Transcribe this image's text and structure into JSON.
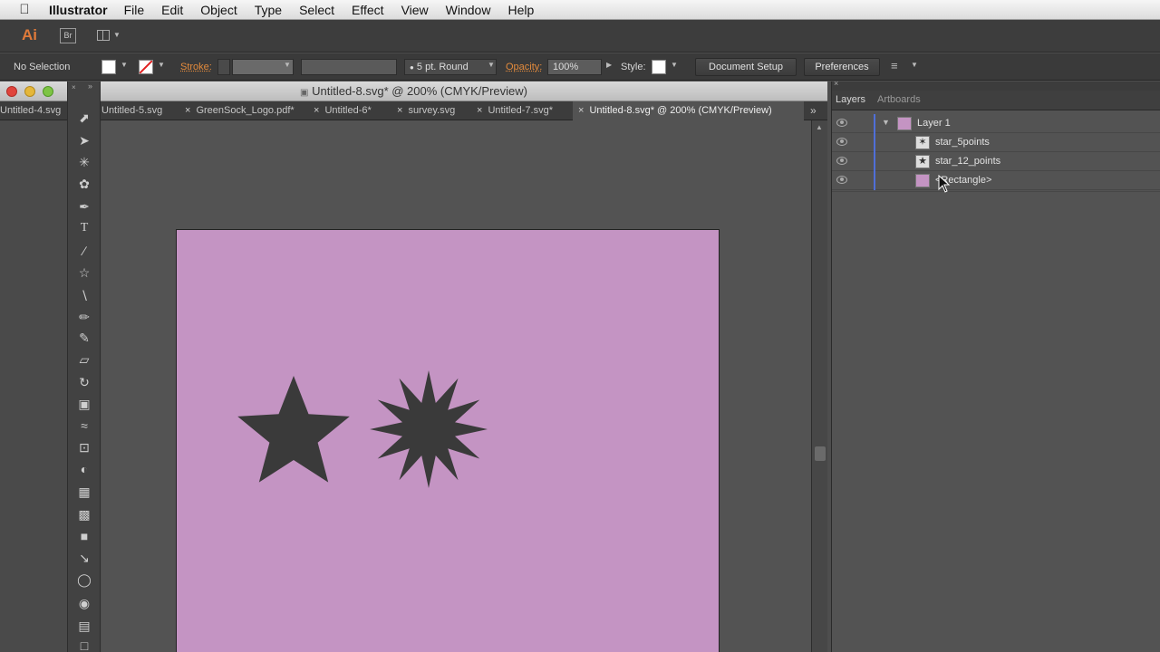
{
  "menubar": {
    "app_name": "Illustrator",
    "items": [
      "File",
      "Edit",
      "Object",
      "Type",
      "Select",
      "Effect",
      "View",
      "Window",
      "Help"
    ]
  },
  "appbar": {
    "ai_logo": "Ai",
    "br_logo": "Br"
  },
  "control_bar": {
    "selection_label": "No Selection",
    "stroke_label": "Stroke:",
    "brush_value": "5 pt. Round",
    "opacity_label": "Opacity:",
    "opacity_value": "100%",
    "style_label": "Style:",
    "document_setup_label": "Document Setup",
    "preferences_label": "Preferences"
  },
  "document": {
    "title": "Untitled-8.svg* @ 200% (CMYK/Preview)",
    "tabs": [
      {
        "label": "Untitled-4.svg"
      },
      {
        "label": "Untitled-5.svg"
      },
      {
        "label": "GreenSock_Logo.pdf*"
      },
      {
        "label": "Untitled-6*"
      },
      {
        "label": "survey.svg"
      },
      {
        "label": "Untitled-7.svg*"
      },
      {
        "label": "Untitled-8.svg* @ 200% (CMYK/Preview)"
      }
    ],
    "artboard_color": "#c494c3",
    "shape_color": "#3a3a3a"
  },
  "layers_panel": {
    "tabs": [
      "Layers",
      "Artboards"
    ],
    "layer_name": "Layer 1",
    "items": [
      "star_5points",
      "star_12_points",
      "<Rectangle>"
    ],
    "accent_color": "#4f6fd8"
  },
  "icons": [
    "apple-icon",
    "arrange-documents-icon",
    "selection-tool-icon",
    "direct-selection-tool-icon",
    "magic-wand-icon",
    "lasso-icon",
    "pen-icon",
    "type-tool-icon",
    "line-tool-icon",
    "star-tool-icon",
    "paintbrush-icon",
    "pencil-icon",
    "blob-brush-icon",
    "eraser-icon",
    "rotate-icon",
    "scale-icon",
    "warp-icon",
    "free-transform-icon",
    "shape-builder-icon",
    "perspective-grid-icon",
    "mesh-icon",
    "gradient-icon",
    "eyedropper-icon",
    "blend-icon",
    "symbol-sprayer-icon",
    "graph-icon",
    "artboard-tool-icon",
    "eye-icon",
    "pointer-cursor-icon"
  ]
}
